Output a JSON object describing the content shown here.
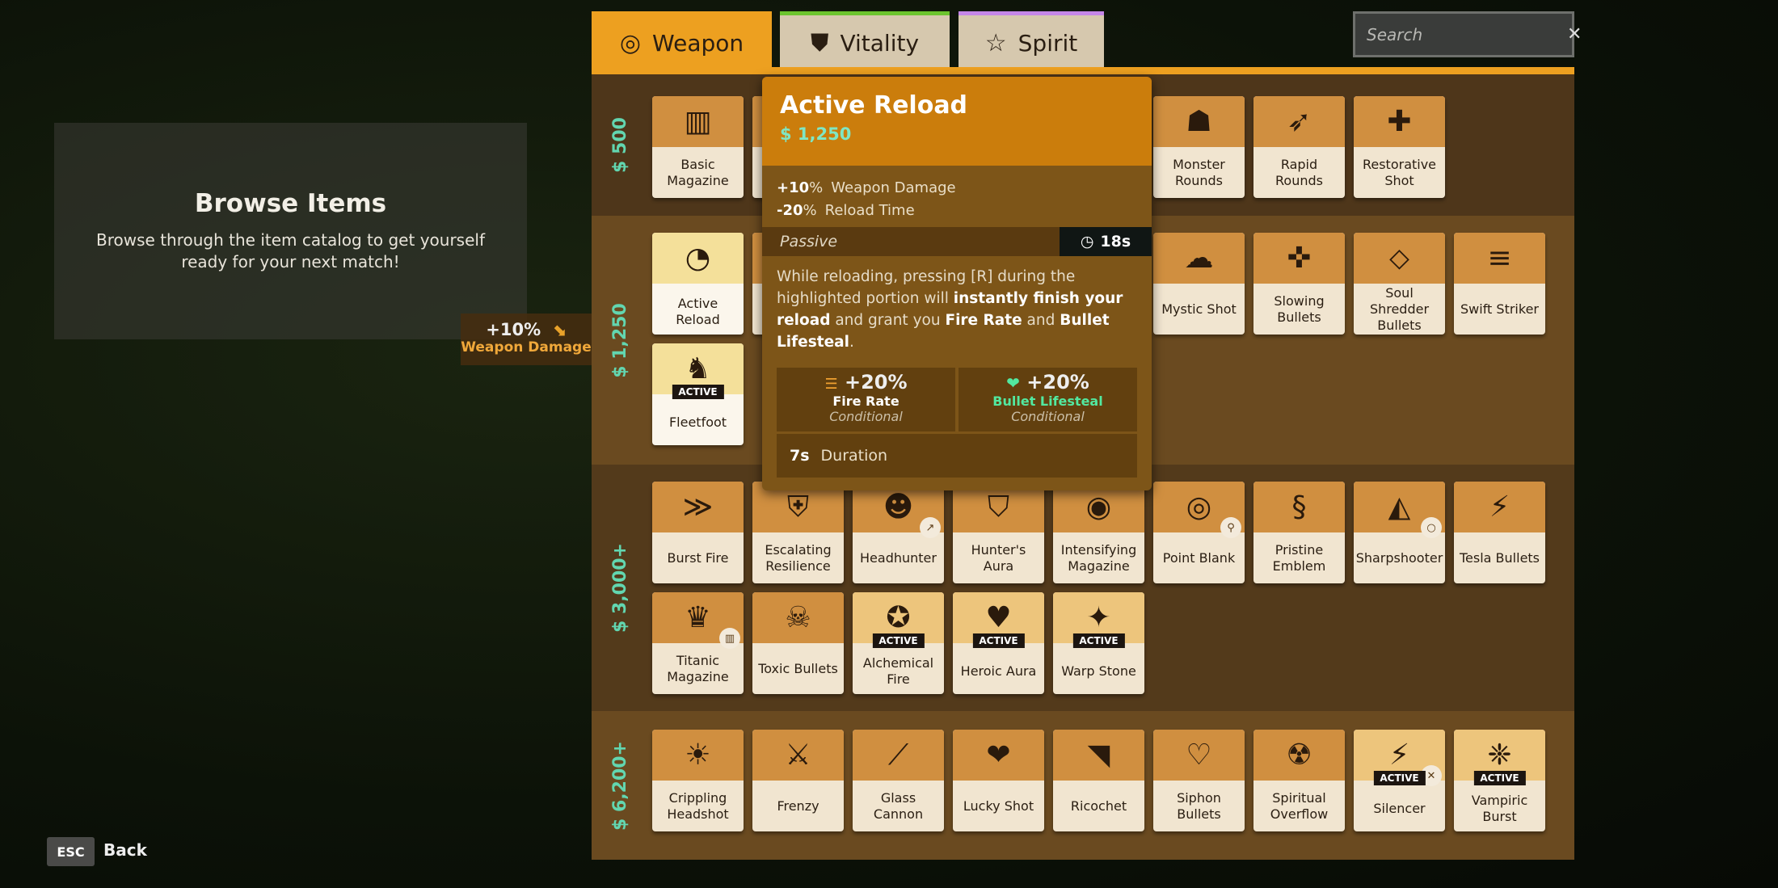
{
  "intro": {
    "title": "Browse Items",
    "text": "Browse through the item catalog to get yourself ready for your next match!"
  },
  "stat_badge": {
    "value": "+10%",
    "label": "Weapon Damage",
    "icon": "weapon-damage-icon"
  },
  "tabs": [
    {
      "label": "Weapon",
      "icon": "weapon-icon",
      "accent": "#eda020",
      "active": true
    },
    {
      "label": "Vitality",
      "icon": "vitality-shield-icon",
      "accent": "#6cc42e"
    },
    {
      "label": "Spirit",
      "icon": "spirit-star-icon",
      "accent": "#c586e8"
    }
  ],
  "search": {
    "placeholder": "Search",
    "value": ""
  },
  "tiers": [
    {
      "cost": "$ 500",
      "items": [
        {
          "name": "Basic Magazine",
          "icon": "▥"
        },
        null,
        null,
        null,
        null,
        {
          "name": "Monster Rounds",
          "icon": "☗"
        },
        {
          "name": "Rapid Rounds",
          "icon": "➶"
        },
        {
          "name": "Restorative Shot",
          "icon": "✚"
        }
      ]
    },
    {
      "cost": "$ 1,250",
      "items": [
        {
          "name": "Active Reload",
          "icon": "◔",
          "selected": true
        },
        null,
        null,
        null,
        null,
        {
          "name": "Mystic Shot",
          "icon": "☁"
        },
        {
          "name": "Slowing Bullets",
          "icon": "✜"
        },
        {
          "name": "Soul Shredder Bullets",
          "icon": "⬦"
        },
        {
          "name": "Swift Striker",
          "icon": "≡"
        },
        {
          "name": "Fleetfoot",
          "icon": "♞",
          "active": true,
          "highlight": true
        }
      ]
    },
    {
      "cost": "$ 3,000+",
      "items": [
        {
          "name": "Burst Fire",
          "icon": "≫"
        },
        {
          "name": "Escalating Resilience",
          "icon": "⛨"
        },
        {
          "name": "Headhunter",
          "icon": "☻",
          "sub": "↗",
          "tag": true
        },
        {
          "name": "Hunter's Aura",
          "icon": "⛉"
        },
        {
          "name": "Intensifying Magazine",
          "icon": "◉"
        },
        {
          "name": "Point Blank",
          "icon": "◎",
          "sub": "⚲"
        },
        {
          "name": "Pristine Emblem",
          "icon": "§"
        },
        {
          "name": "Sharpshooter",
          "icon": "◭",
          "sub": "○"
        },
        {
          "name": "Tesla Bullets",
          "icon": "⚡"
        },
        {
          "name": "Titanic Magazine",
          "icon": "♛",
          "sub": "▥"
        },
        {
          "name": "Toxic Bullets",
          "icon": "☠"
        },
        {
          "name": "Alchemical Fire",
          "icon": "✪",
          "active": true
        },
        {
          "name": "Heroic Aura",
          "icon": "♥",
          "active": true
        },
        {
          "name": "Warp Stone",
          "icon": "✦",
          "active": true
        }
      ]
    },
    {
      "cost": "$ 6,200+",
      "items": [
        {
          "name": "Crippling Headshot",
          "icon": "☀"
        },
        {
          "name": "Frenzy",
          "icon": "⚔"
        },
        {
          "name": "Glass Cannon",
          "icon": "⟋"
        },
        {
          "name": "Lucky Shot",
          "icon": "❤"
        },
        {
          "name": "Ricochet",
          "icon": "◥"
        },
        {
          "name": "Siphon Bullets",
          "icon": "♡"
        },
        {
          "name": "Spiritual Overflow",
          "icon": "☢"
        },
        {
          "name": "Silencer",
          "icon": "⚡",
          "active": true,
          "sub": "✕"
        },
        {
          "name": "Vampiric Burst",
          "icon": "❈",
          "active": true
        }
      ]
    }
  ],
  "active_badge": "ACTIVE",
  "tooltip": {
    "title": "Active Reload",
    "cost": "$ 1,250",
    "stats": [
      {
        "value": "+10",
        "unit": "%",
        "label": "Weapon Damage"
      },
      {
        "value": "-20",
        "unit": "%",
        "label": "Reload Time"
      }
    ],
    "type": "Passive",
    "cooldown": "18s",
    "desc_parts": [
      "While reloading, pressing [R] during the highlighted portion will ",
      "instantly finish your reload",
      " and grant you ",
      "Fire Rate",
      " and ",
      "Bullet Lifesteal",
      "."
    ],
    "boxes": [
      {
        "value": "+20%",
        "label": "Fire Rate",
        "note": "Conditional",
        "icon": "fire-rate-icon"
      },
      {
        "value": "+20%",
        "label": "Bullet Lifesteal",
        "note": "Conditional",
        "icon": "lifesteal-icon",
        "color": "#52e8a0"
      }
    ],
    "duration_value": "7s",
    "duration_label": "Duration"
  },
  "footer": {
    "esc": "ESC",
    "back": "Back"
  }
}
